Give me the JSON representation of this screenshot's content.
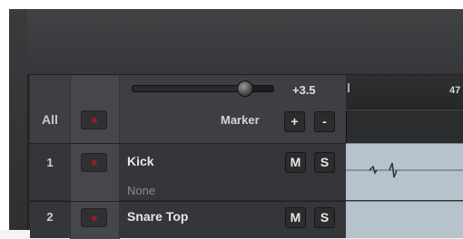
{
  "fader": {
    "value_label": "+3.5",
    "level_fraction": 0.82
  },
  "header": {
    "all_label": "All",
    "marker_label": "Marker",
    "add_label": "+",
    "remove_label": "-"
  },
  "timeline": {
    "bar_number": "47"
  },
  "tracks": [
    {
      "number": "1",
      "name": "Kick",
      "sub": "None",
      "mute_label": "M",
      "solo_label": "S"
    },
    {
      "number": "2",
      "name": "Snare Top",
      "mute_label": "M",
      "solo_label": "S"
    }
  ],
  "colors": {
    "record_dot": "#9a1a2a",
    "lane": "#b7c3cc",
    "panel": "#3d3f42"
  }
}
